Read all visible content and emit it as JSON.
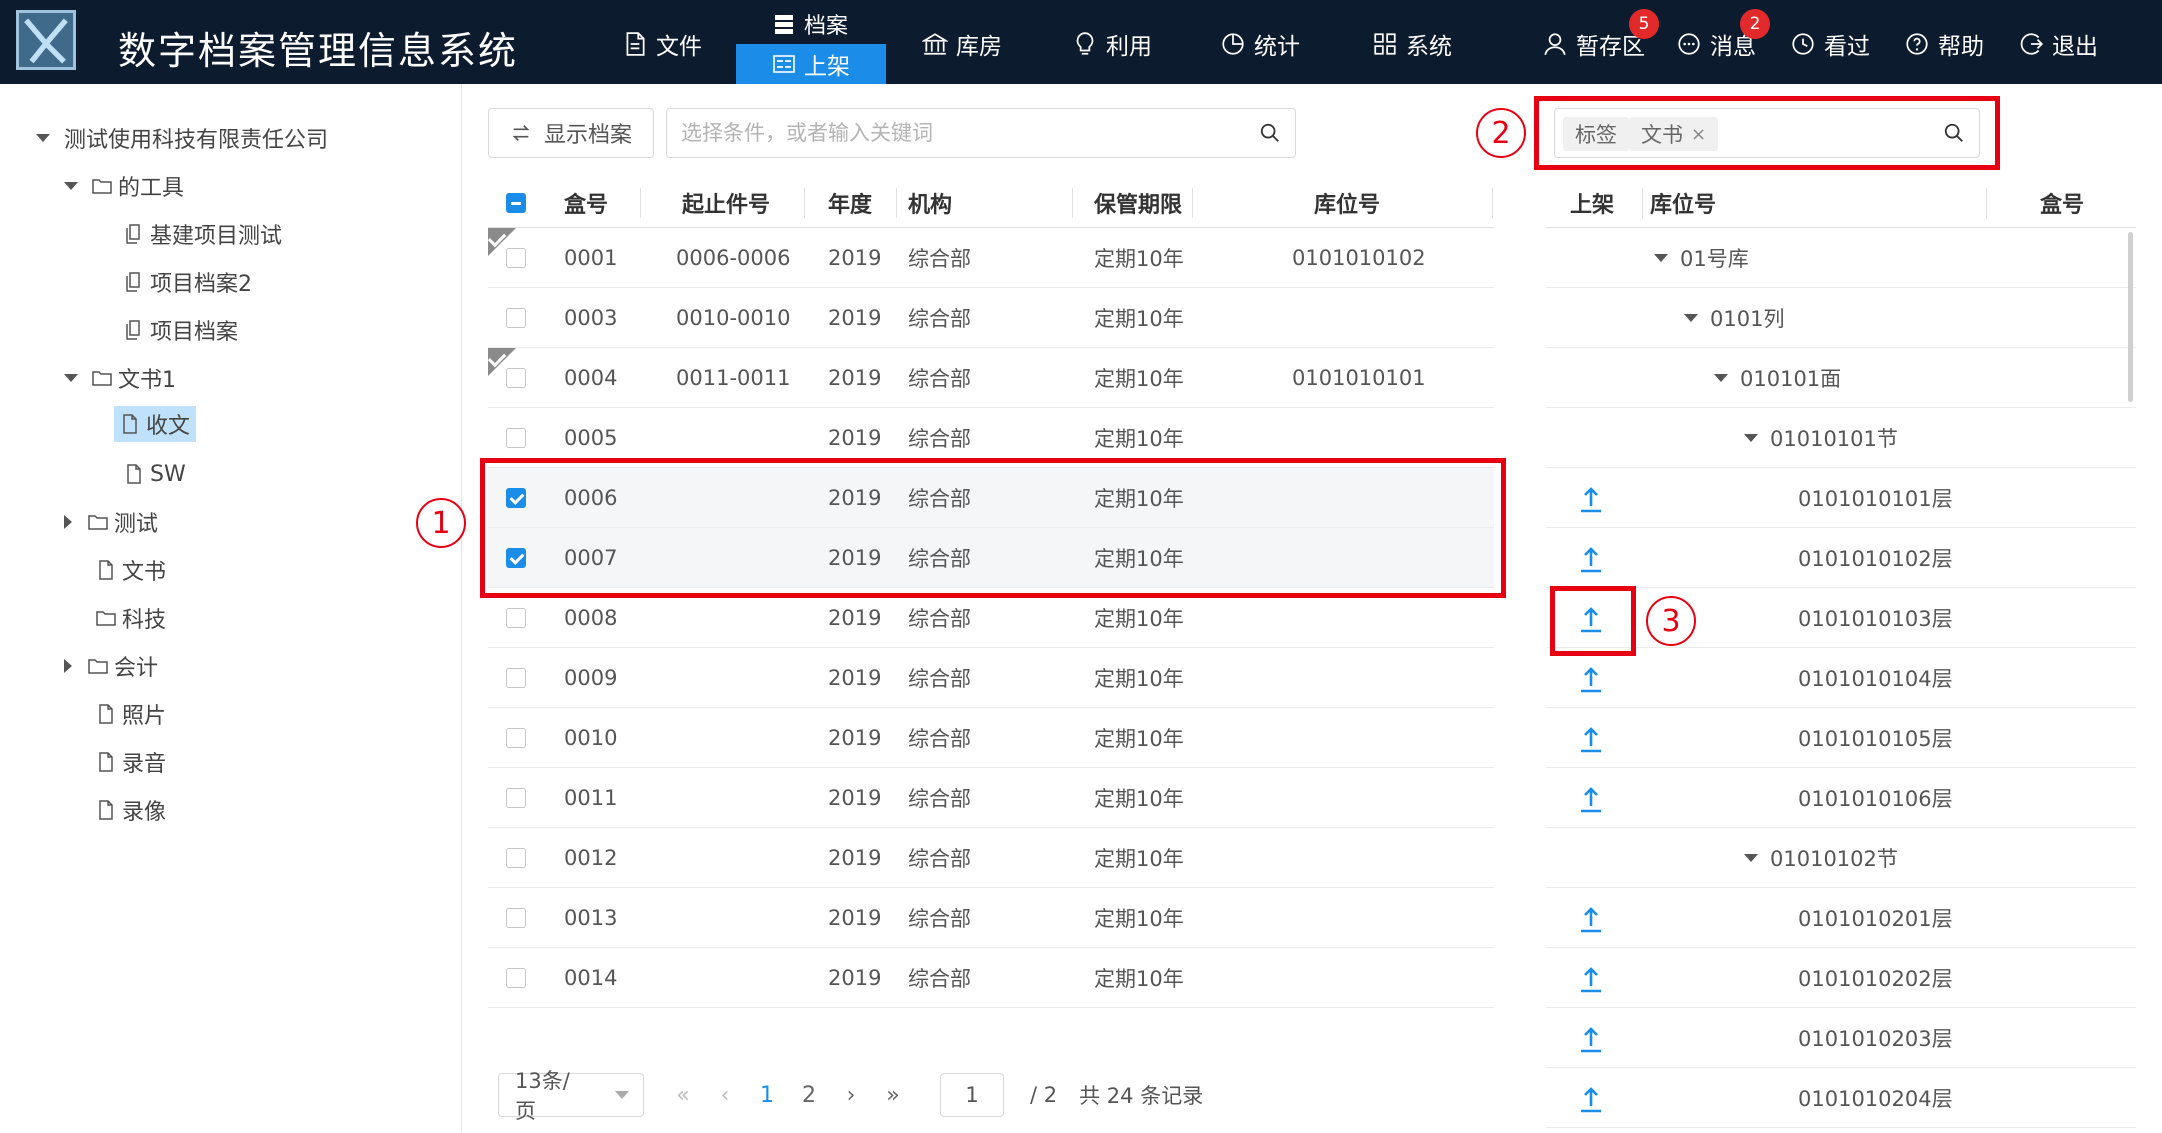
{
  "app": {
    "title": "数字档案管理信息系统"
  },
  "nav": {
    "file": "文件",
    "archive": "档案",
    "shelve": "上架",
    "warehouse": "库房",
    "use": "利用",
    "stats": "统计",
    "system": "系统",
    "staging": "暂存区",
    "staging_badge": "5",
    "messages": "消息",
    "messages_badge": "2",
    "viewed": "看过",
    "help": "帮助",
    "logout": "退出"
  },
  "tree": {
    "root": "测试使用科技有限责任公司",
    "n1": "的工具",
    "n1a": "基建项目测试",
    "n1b": "项目档案2",
    "n1c": "项目档案",
    "n2": "文书1",
    "n2a": "收文",
    "n2b": "SW",
    "n3": "测试",
    "n4": "文书",
    "n5": "科技",
    "n6": "会计",
    "n7": "照片",
    "n8": "录音",
    "n9": "录像"
  },
  "toolbar": {
    "show_archive": "显示档案",
    "search_placeholder": "选择条件，或者输入关键词"
  },
  "table": {
    "headers": {
      "box": "盒号",
      "range": "起止件号",
      "year": "年度",
      "org": "机构",
      "term": "保管期限",
      "loc": "库位号"
    },
    "rows": [
      {
        "box": "0001",
        "range": "0006-0006",
        "year": "2019",
        "org": "综合部",
        "term": "定期10年",
        "loc": "0101010102"
      },
      {
        "box": "0003",
        "range": "0010-0010",
        "year": "2019",
        "org": "综合部",
        "term": "定期10年",
        "loc": ""
      },
      {
        "box": "0004",
        "range": "0011-0011",
        "year": "2019",
        "org": "综合部",
        "term": "定期10年",
        "loc": "0101010101"
      },
      {
        "box": "0005",
        "range": "",
        "year": "2019",
        "org": "综合部",
        "term": "定期10年",
        "loc": ""
      },
      {
        "box": "0006",
        "range": "",
        "year": "2019",
        "org": "综合部",
        "term": "定期10年",
        "loc": ""
      },
      {
        "box": "0007",
        "range": "",
        "year": "2019",
        "org": "综合部",
        "term": "定期10年",
        "loc": ""
      },
      {
        "box": "0008",
        "range": "",
        "year": "2019",
        "org": "综合部",
        "term": "定期10年",
        "loc": ""
      },
      {
        "box": "0009",
        "range": "",
        "year": "2019",
        "org": "综合部",
        "term": "定期10年",
        "loc": ""
      },
      {
        "box": "0010",
        "range": "",
        "year": "2019",
        "org": "综合部",
        "term": "定期10年",
        "loc": ""
      },
      {
        "box": "0011",
        "range": "",
        "year": "2019",
        "org": "综合部",
        "term": "定期10年",
        "loc": ""
      },
      {
        "box": "0012",
        "range": "",
        "year": "2019",
        "org": "综合部",
        "term": "定期10年",
        "loc": ""
      },
      {
        "box": "0013",
        "range": "",
        "year": "2019",
        "org": "综合部",
        "term": "定期10年",
        "loc": ""
      },
      {
        "box": "0014",
        "range": "",
        "year": "2019",
        "org": "综合部",
        "term": "定期10年",
        "loc": ""
      }
    ]
  },
  "pager": {
    "size": "13条/页",
    "page1": "1",
    "page2": "2",
    "current": "1",
    "total_pages": "/ 2",
    "total": "共 24 条记录"
  },
  "right": {
    "tag_label": "标签",
    "tag_value": "文书",
    "headers": {
      "shelve": "上架",
      "loc": "库位号",
      "box": "盒号"
    },
    "rows": [
      {
        "label": "01号库",
        "kind": "group"
      },
      {
        "label": "0101列",
        "kind": "group"
      },
      {
        "label": "010101面",
        "kind": "group"
      },
      {
        "label": "01010101节",
        "kind": "group"
      },
      {
        "label": "0101010101层",
        "kind": "leaf"
      },
      {
        "label": "0101010102层",
        "kind": "leaf"
      },
      {
        "label": "0101010103层",
        "kind": "leaf"
      },
      {
        "label": "0101010104层",
        "kind": "leaf"
      },
      {
        "label": "0101010105层",
        "kind": "leaf"
      },
      {
        "label": "0101010106层",
        "kind": "leaf"
      },
      {
        "label": "01010102节",
        "kind": "group"
      },
      {
        "label": "0101010201层",
        "kind": "leaf"
      },
      {
        "label": "0101010202层",
        "kind": "leaf"
      },
      {
        "label": "0101010203层",
        "kind": "leaf"
      },
      {
        "label": "0101010204层",
        "kind": "leaf"
      }
    ]
  },
  "annotations": {
    "a1": "1",
    "a2": "2",
    "a3": "3"
  },
  "colors": {
    "header_bg": "#0d1b2e",
    "accent": "#1b8de8",
    "highlight": "#e60012",
    "badge": "#e32a2a"
  }
}
